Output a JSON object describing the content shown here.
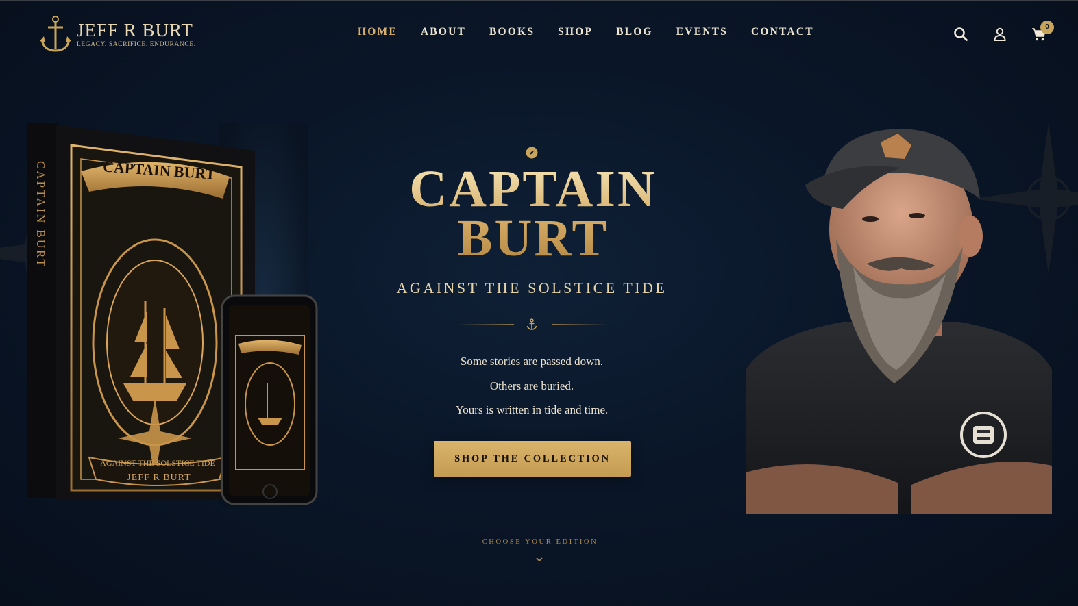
{
  "header": {
    "logo": {
      "name": "JEFF R BURT",
      "tagline": "LEGACY. SACRIFICE. ENDURANCE."
    },
    "nav": [
      "HOME",
      "ABOUT",
      "BOOKS",
      "SHOP",
      "BLOG",
      "EVENTS",
      "CONTACT"
    ],
    "active_nav": "HOME",
    "icons": [
      "search-icon",
      "user-icon",
      "cart-icon"
    ],
    "cart_count": "0"
  },
  "hero": {
    "title_line1": "CAPTAIN",
    "title_line2": "BURT",
    "subtitle": "AGAINST THE SOLSTICE TIDE",
    "lines": [
      "Some stories are passed down.",
      "Others are buried.",
      "Yours is written in tide and time."
    ],
    "cta": "SHOP THE COLLECTION",
    "scroll_hint": "CHOOSE YOUR EDITION"
  },
  "book": {
    "cover_title": "CAPTAIN BURT",
    "spine_title": "CAPTAIN BURT",
    "cover_subtitle": "AGAINST THE SOLSTICE TIDE",
    "cover_author": "JEFF R BURT"
  },
  "colors": {
    "background": "#0a1628",
    "gold": "#d8b06a",
    "text": "#efe6d2"
  }
}
